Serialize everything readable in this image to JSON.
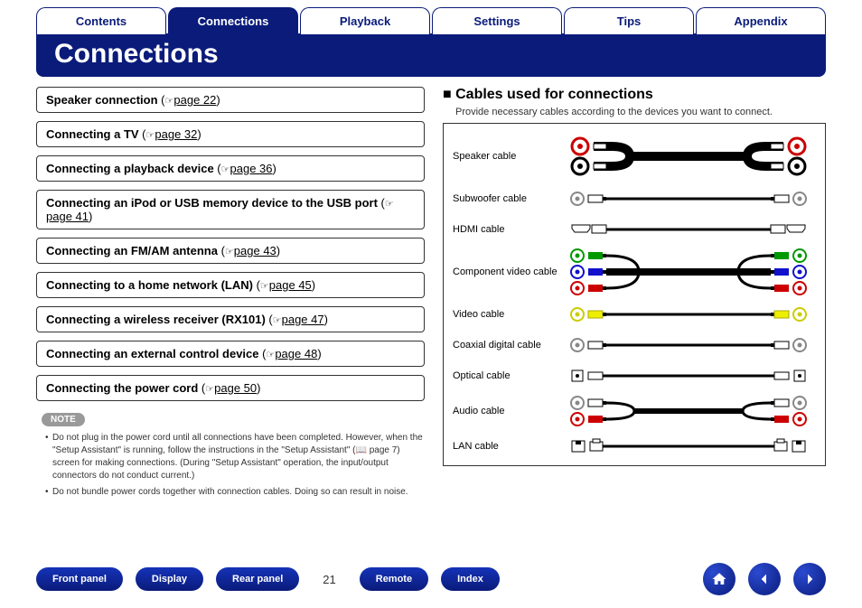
{
  "tabs": [
    {
      "label": "Contents",
      "active": false
    },
    {
      "label": "Connections",
      "active": true
    },
    {
      "label": "Playback",
      "active": false
    },
    {
      "label": "Settings",
      "active": false
    },
    {
      "label": "Tips",
      "active": false
    },
    {
      "label": "Appendix",
      "active": false
    }
  ],
  "title": "Connections",
  "links": [
    {
      "label": "Speaker connection",
      "page": "page 22"
    },
    {
      "label": "Connecting a TV",
      "page": "page 32"
    },
    {
      "label": "Connecting a playback device",
      "page": "page 36"
    },
    {
      "label": "Connecting an iPod or USB memory device to the USB port",
      "page": "page 41"
    },
    {
      "label": "Connecting an FM/AM antenna",
      "page": "page 43"
    },
    {
      "label": "Connecting to a home network (LAN)",
      "page": "page 45"
    },
    {
      "label": "Connecting a wireless receiver (RX101)",
      "page": "page 47"
    },
    {
      "label": "Connecting an external control device",
      "page": "page 48"
    },
    {
      "label": "Connecting the power cord",
      "page": "page 50"
    }
  ],
  "note": {
    "badge": "NOTE",
    "items": [
      "Do not plug in the power cord until all connections have been completed. However, when the \"Setup Assistant\" is running, follow the instructions in the \"Setup Assistant\" (📖 page 7) screen for making connections. (During \"Setup Assistant\" operation, the input/output connectors do not conduct current.)",
      "Do not bundle power cords together with connection cables. Doing so can result in noise."
    ]
  },
  "cables_section": {
    "title": "Cables used for connections",
    "subtitle": "Provide necessary cables according to the devices you want to connect.",
    "rows": [
      {
        "label": "Speaker cable"
      },
      {
        "label": "Subwoofer cable"
      },
      {
        "label": "HDMI cable"
      },
      {
        "label": "Component video cable"
      },
      {
        "label": "Video cable"
      },
      {
        "label": "Coaxial digital cable"
      },
      {
        "label": "Optical cable"
      },
      {
        "label": "Audio cable"
      },
      {
        "label": "LAN cable"
      }
    ]
  },
  "footer": {
    "buttons": [
      "Front panel",
      "Display",
      "Rear panel",
      "Remote",
      "Index"
    ],
    "page_number": "21"
  }
}
